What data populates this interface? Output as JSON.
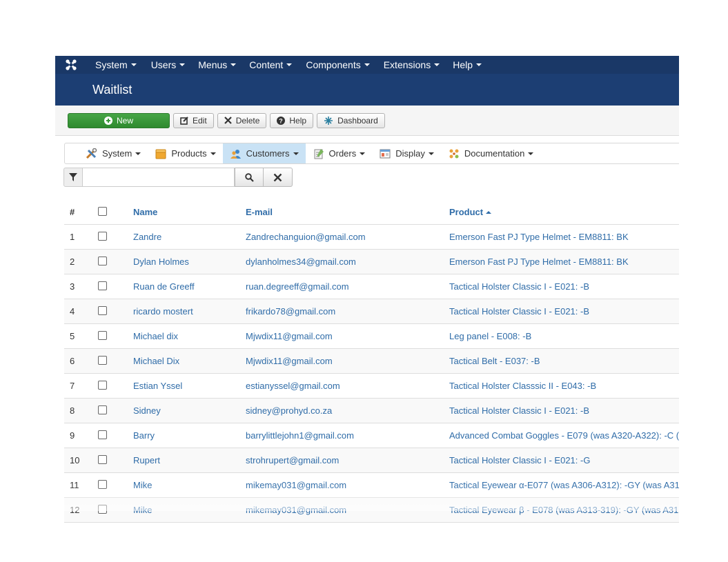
{
  "topmenu": {
    "items": [
      {
        "label": "System"
      },
      {
        "label": "Users"
      },
      {
        "label": "Menus"
      },
      {
        "label": "Content"
      },
      {
        "label": "Components"
      },
      {
        "label": "Extensions"
      },
      {
        "label": "Help"
      }
    ]
  },
  "page": {
    "title": "Waitlist"
  },
  "toolbar": {
    "new_label": "New",
    "edit_label": "Edit",
    "delete_label": "Delete",
    "help_label": "Help",
    "dashboard_label": "Dashboard"
  },
  "submenu": {
    "items": [
      {
        "label": "System",
        "icon": "tools-icon"
      },
      {
        "label": "Products",
        "icon": "box-icon"
      },
      {
        "label": "Customers",
        "icon": "users-icon",
        "active": true
      },
      {
        "label": "Orders",
        "icon": "orders-icon"
      },
      {
        "label": "Display",
        "icon": "display-icon"
      },
      {
        "label": "Documentation",
        "icon": "documentation-icon"
      }
    ]
  },
  "filter": {
    "search_value": "",
    "placeholder": ""
  },
  "table": {
    "headers": {
      "num": "#",
      "name": "Name",
      "email": "E-mail",
      "product": "Product"
    },
    "sort": {
      "column": "product",
      "direction": "asc"
    },
    "rows": [
      {
        "num": "1",
        "name": "Zandre",
        "email": "Zandrechanguion@gmail.com",
        "product": "Emerson Fast PJ Type Helmet - EM8811: BK"
      },
      {
        "num": "2",
        "name": "Dylan Holmes",
        "email": "dylanholmes34@gmail.com",
        "product": "Emerson Fast PJ Type Helmet - EM8811: BK"
      },
      {
        "num": "3",
        "name": "Ruan de Greeff",
        "email": "ruan.degreeff@gmail.com",
        "product": "Tactical Holster Classic I - E021: -B"
      },
      {
        "num": "4",
        "name": "ricardo mostert",
        "email": "frikardo78@gmail.com",
        "product": "Tactical Holster Classic I - E021: -B"
      },
      {
        "num": "5",
        "name": "Michael dix",
        "email": "Mjwdix11@gmail.com",
        "product": "Leg panel - E008: -B"
      },
      {
        "num": "6",
        "name": "Michael Dix",
        "email": "Mjwdix11@gmail.com",
        "product": "Tactical Belt - E037: -B"
      },
      {
        "num": "7",
        "name": "Estian Yssel",
        "email": "estianyssel@gmail.com",
        "product": "Tactical Holster Classsic II - E043: -B"
      },
      {
        "num": "8",
        "name": "Sidney",
        "email": "sidney@prohyd.co.za",
        "product": "Tactical Holster Classic I - E021: -B"
      },
      {
        "num": "9",
        "name": "Barry",
        "email": "barrylittlejohn1@gmail.com",
        "product": "Advanced Combat Goggles - E079 (was A320-A322): -C (w"
      },
      {
        "num": "10",
        "name": "Rupert",
        "email": "strohrupert@gmail.com",
        "product": "Tactical Holster Classic I - E021: -G"
      },
      {
        "num": "11",
        "name": "Mike",
        "email": "mikemay031@gmail.com",
        "product": "Tactical Eyewear α-E077 (was A306-A312): -GY (was A31"
      },
      {
        "num": "12",
        "name": "Mike",
        "email": "mikemay031@gmail.com",
        "product": "Tactical Eyewear β - E078 (was A313-319): -GY (was A31"
      }
    ]
  }
}
